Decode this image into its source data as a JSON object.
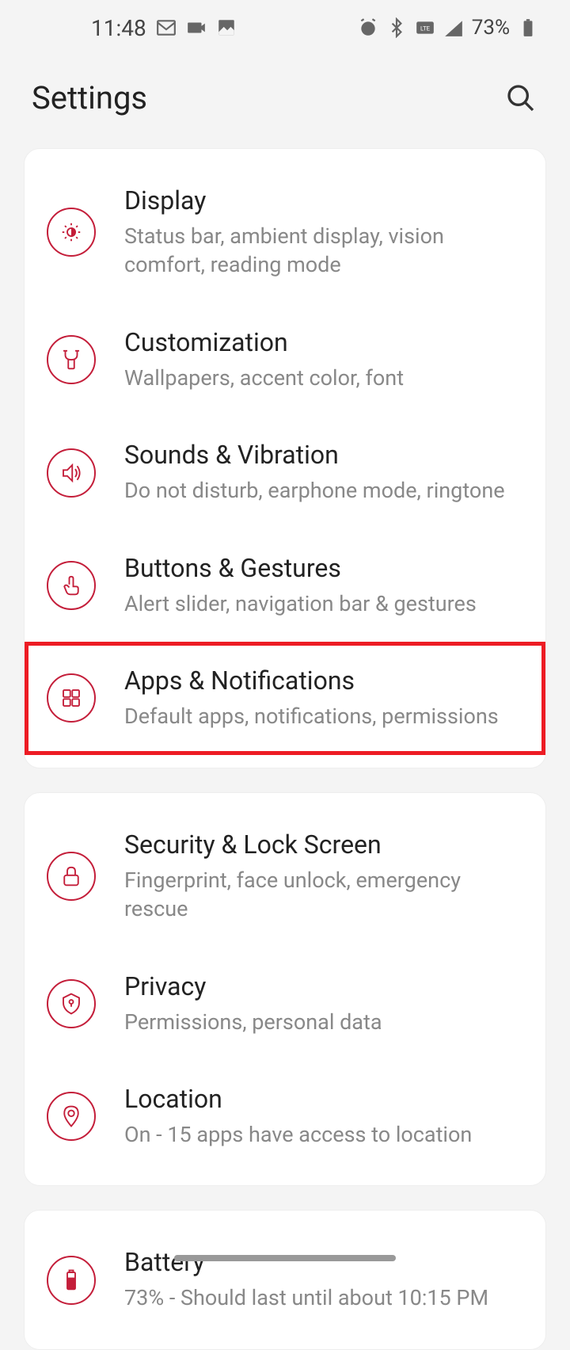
{
  "status": {
    "time": "11:48",
    "battery_percent": "73%"
  },
  "header": {
    "title": "Settings"
  },
  "groups": [
    {
      "items": [
        {
          "title": "Display",
          "subtitle": "Status bar, ambient display, vision comfort, reading mode"
        },
        {
          "title": "Customization",
          "subtitle": "Wallpapers, accent color, font"
        },
        {
          "title": "Sounds & Vibration",
          "subtitle": "Do not disturb, earphone mode, ringtone"
        },
        {
          "title": "Buttons & Gestures",
          "subtitle": "Alert slider, navigation bar & gestures"
        },
        {
          "title": "Apps & Notifications",
          "subtitle": "Default apps, notifications, permissions"
        }
      ]
    },
    {
      "items": [
        {
          "title": "Security & Lock Screen",
          "subtitle": "Fingerprint, face unlock, emergency rescue"
        },
        {
          "title": "Privacy",
          "subtitle": "Permissions, personal data"
        },
        {
          "title": "Location",
          "subtitle": "On - 15 apps have access to location"
        }
      ]
    },
    {
      "items": [
        {
          "title": "Battery",
          "subtitle": "73% - Should last until about 10:15 PM"
        }
      ]
    }
  ]
}
